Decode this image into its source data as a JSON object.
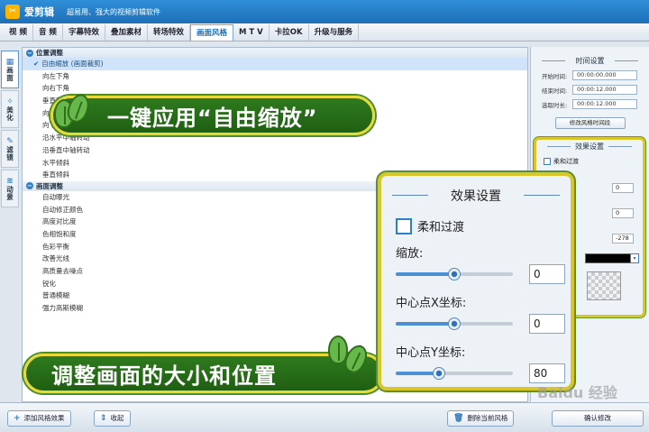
{
  "app": {
    "name": "爱剪辑",
    "slogan": "超易用、强大的视频剪辑软件"
  },
  "menu": {
    "tabs": [
      "视 频",
      "音 频",
      "字幕特效",
      "叠加素材",
      "转场特效",
      "画面风格",
      "M T V",
      "卡拉OK",
      "升级与服务"
    ],
    "active_index": 5
  },
  "side_tabs": [
    {
      "label": "画面",
      "icon": "grid-icon"
    },
    {
      "label": "美化",
      "icon": "wand-icon"
    },
    {
      "label": "滤镜",
      "icon": "brush-icon"
    },
    {
      "label": "动景",
      "icon": "wave-icon"
    }
  ],
  "list": {
    "group1": {
      "label": "位置调整",
      "items": [
        "自由缩放 (画面裁剪)",
        "向左下角",
        "向右下角",
        "垂直翻转",
        "向上摆动",
        "向下摆动",
        "沿水平中轴转动",
        "沿垂直中轴转动",
        "水平倾斜",
        "垂直倾斜"
      ],
      "selected_index": 0
    },
    "group2": {
      "label": "画面调整",
      "items": [
        "自动曝光",
        "自动修正颜色",
        "高度对比度",
        "色相饱和度",
        "色彩平衡",
        "改善光线",
        "高质量去噪点",
        "锐化",
        "普通模糊",
        "强力高斯模糊"
      ]
    }
  },
  "banners": {
    "top": "一键应用“自由缩放”",
    "bottom": "调整画面的大小和位置"
  },
  "bottom": {
    "add_effect": "添加风格效果",
    "collapse": "收起",
    "delete_effect": "删除当前风格",
    "confirm": "确认修改"
  },
  "time_settings": {
    "title": "时间设置",
    "start_label": "开始时间:",
    "start_value": "00:00:00.000",
    "end_label": "结束时间:",
    "end_value": "00:00:12.000",
    "duration_label": "选取时长:",
    "duration_value": "00:00:12.000",
    "modify_button": "修改风格时间段"
  },
  "effect_small": {
    "title": "效果设置",
    "soft_label": "柔和过渡",
    "v1": "0",
    "v2": "0",
    "v3": "-278"
  },
  "effect_zoom": {
    "title": "效果设置",
    "soft_label": "柔和过渡",
    "scale_label": "缩放:",
    "scale_value": "0",
    "scale_pos": 0.5,
    "cx_label": "中心点X坐标:",
    "cx_value": "0",
    "cx_pos": 0.5,
    "cy_label": "中心点Y坐标:",
    "cy_value": "80",
    "cy_pos": 0.37
  },
  "watermark": "Baidu 经验"
}
